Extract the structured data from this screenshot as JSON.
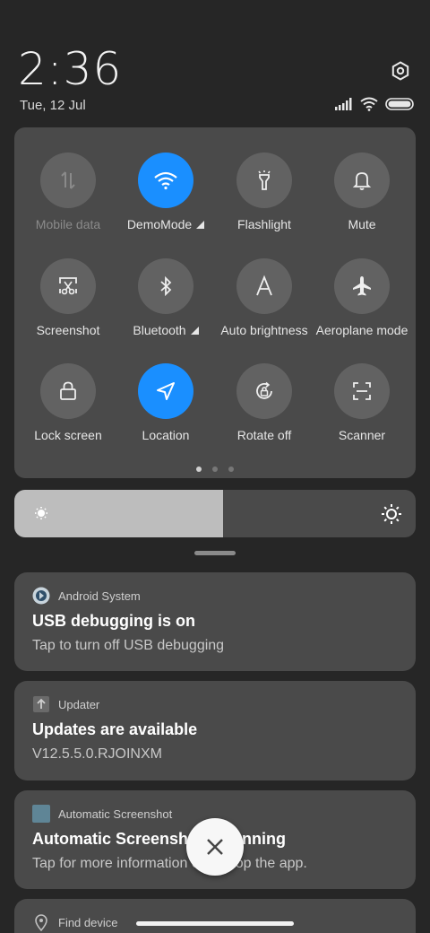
{
  "status": {
    "time": "2:36",
    "date": "Tue, 12 Jul"
  },
  "quick_settings": {
    "tiles": [
      {
        "label": "Mobile data",
        "icon": "mobile-data-icon",
        "state": "disabled"
      },
      {
        "label": "DemoMode",
        "icon": "wifi-icon",
        "state": "active",
        "expandable": true
      },
      {
        "label": "Flashlight",
        "icon": "flashlight-icon",
        "state": "inactive"
      },
      {
        "label": "Mute",
        "icon": "bell-icon",
        "state": "inactive"
      },
      {
        "label": "Screenshot",
        "icon": "screenshot-icon",
        "state": "inactive"
      },
      {
        "label": "Bluetooth",
        "icon": "bluetooth-icon",
        "state": "inactive",
        "expandable": true
      },
      {
        "label": "Auto brightness",
        "icon": "auto-brightness-icon",
        "state": "inactive"
      },
      {
        "label": "Aeroplane mode",
        "icon": "airplane-icon",
        "state": "inactive"
      },
      {
        "label": "Lock screen",
        "icon": "lock-icon",
        "state": "inactive"
      },
      {
        "label": "Location",
        "icon": "location-icon",
        "state": "active"
      },
      {
        "label": "Rotate off",
        "icon": "rotate-lock-icon",
        "state": "inactive"
      },
      {
        "label": "Scanner",
        "icon": "scanner-icon",
        "state": "inactive"
      }
    ],
    "page_count": 3,
    "current_page": 1
  },
  "brightness": {
    "level": 0.52
  },
  "notifications": [
    {
      "app": "Android System",
      "title": "USB debugging is on",
      "text": "Tap to turn off USB debugging"
    },
    {
      "app": "Updater",
      "title": "Updates are available",
      "text": "V12.5.5.0.RJOINXM"
    },
    {
      "app": "Automatic Screenshot",
      "title": "Automatic Screenshot is running",
      "text": "Tap for more information or to stop the app."
    },
    {
      "app": "Find device",
      "title": "",
      "text": ""
    }
  ],
  "colors": {
    "active": "#1a8fff",
    "panel": "#4a4a4a",
    "background": "#262626"
  }
}
